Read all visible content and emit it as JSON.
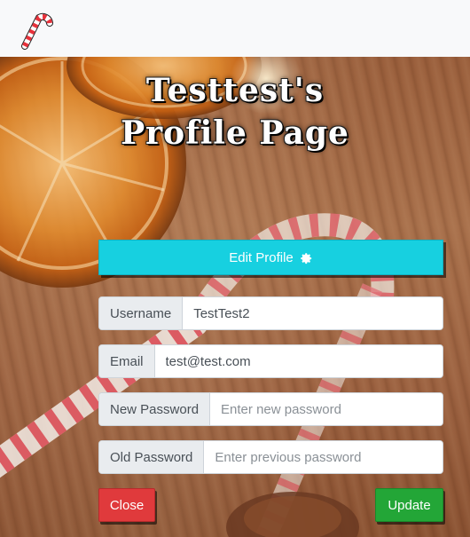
{
  "navbar": {
    "logo_icon": "candy-cane-icon"
  },
  "page": {
    "title": "Testtest's Profile Page"
  },
  "edit_button": {
    "label": "Edit Profile",
    "icon": "gear-icon"
  },
  "form": {
    "username": {
      "label": "Username",
      "value": "TestTest2"
    },
    "email": {
      "label": "Email",
      "value": "test@test.com"
    },
    "new_password": {
      "label": "New Password",
      "placeholder": "Enter new password"
    },
    "old_password": {
      "label": "Old Password",
      "placeholder": "Enter previous password"
    }
  },
  "buttons": {
    "close_label": "Close",
    "update_label": "Update"
  },
  "colors": {
    "edit_button": "#17d0e0",
    "close_button": "#e03a3c",
    "update_button": "#23a637",
    "wood_background": "#9a5f3c"
  }
}
